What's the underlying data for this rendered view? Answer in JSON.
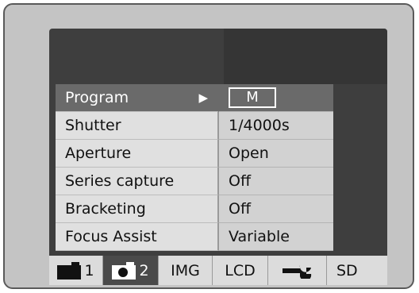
{
  "menu": {
    "rows": [
      {
        "label": "Program",
        "value": "M",
        "arrow": "▶",
        "selected": true
      },
      {
        "label": "Shutter",
        "value": "1/4000s"
      },
      {
        "label": "Aperture",
        "value": "Open"
      },
      {
        "label": "Series capture",
        "value": "Off"
      },
      {
        "label": "Bracketing",
        "value": "Off"
      },
      {
        "label": "Focus Assist",
        "value": "Variable"
      }
    ]
  },
  "tabs": [
    {
      "icon": "camera-icon",
      "label": "1",
      "active": true
    },
    {
      "icon": "camera-icon",
      "label": "2",
      "active": false
    },
    {
      "label": "IMG"
    },
    {
      "label": "LCD"
    },
    {
      "icon": "wrench-icon"
    },
    {
      "label": "SD"
    }
  ]
}
